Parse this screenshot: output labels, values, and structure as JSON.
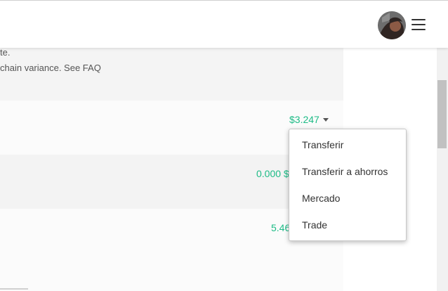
{
  "header": {
    "avatar_label": "",
    "menu_label": ""
  },
  "notice": {
    "line_1": "te.",
    "line_2": "chain variance. See FAQ"
  },
  "wallet_rows": [
    {
      "amount": "$3.247"
    },
    {
      "amount": "0.000 $"
    },
    {
      "amount": "5.46"
    }
  ],
  "dropdown": {
    "items": [
      {
        "label": "Transferir"
      },
      {
        "label": "Transferir a ahorros"
      },
      {
        "label": "Mercado"
      },
      {
        "label": "Trade"
      }
    ]
  },
  "icons": {
    "avatar": "avatar-icon",
    "menu": "hamburger-menu-icon",
    "caret": "chevron-down-icon"
  },
  "colors": {
    "accent_green": "#1dbb86",
    "text_dark": "#333333",
    "text_muted": "#555555",
    "panel_gray": "#f4f4f4"
  }
}
